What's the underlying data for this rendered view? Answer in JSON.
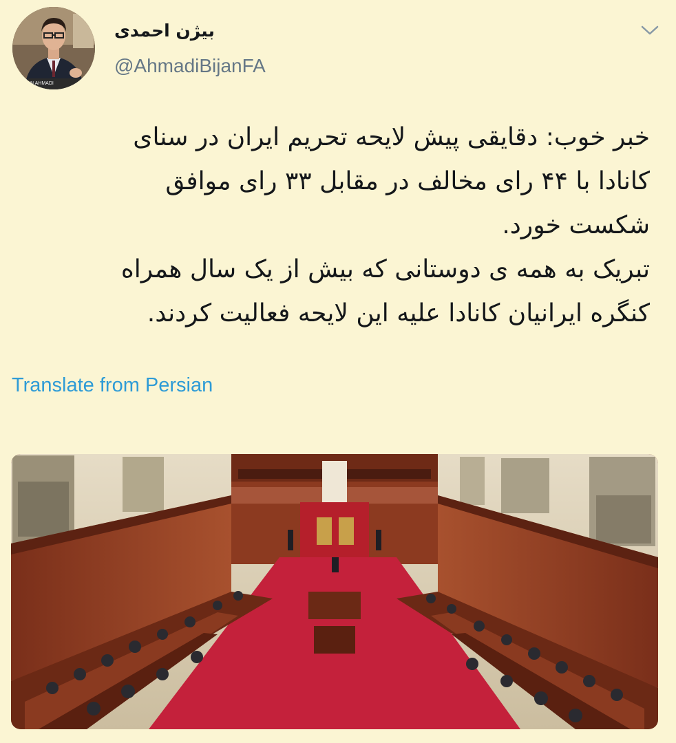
{
  "tweet": {
    "display_name": "بیژن احمدی",
    "handle": "@AhmadiBijanFA",
    "avatar_badge": "N AHMADI",
    "body_lines": [
      "خبر خوب: دقایقی پیش لایحه تحریم ایران در سنای",
      "کانادا با ۴۴ رای مخالف در مقابل ۳۳ رای موافق",
      "شکست خورد.",
      "تبریک به همه ی دوستانی که بیش از یک سال همراه",
      "کنگره ایرانیان کانادا علیه این لایحه فعالیت کردند."
    ],
    "translate_label": "Translate from Persian"
  },
  "icons": {
    "menu": "chevron-down-icon"
  },
  "colors": {
    "background": "#fbf5d3",
    "text": "#14171a",
    "handle": "#657786",
    "link": "#2e9bd6",
    "carpet": "#c4213b"
  }
}
